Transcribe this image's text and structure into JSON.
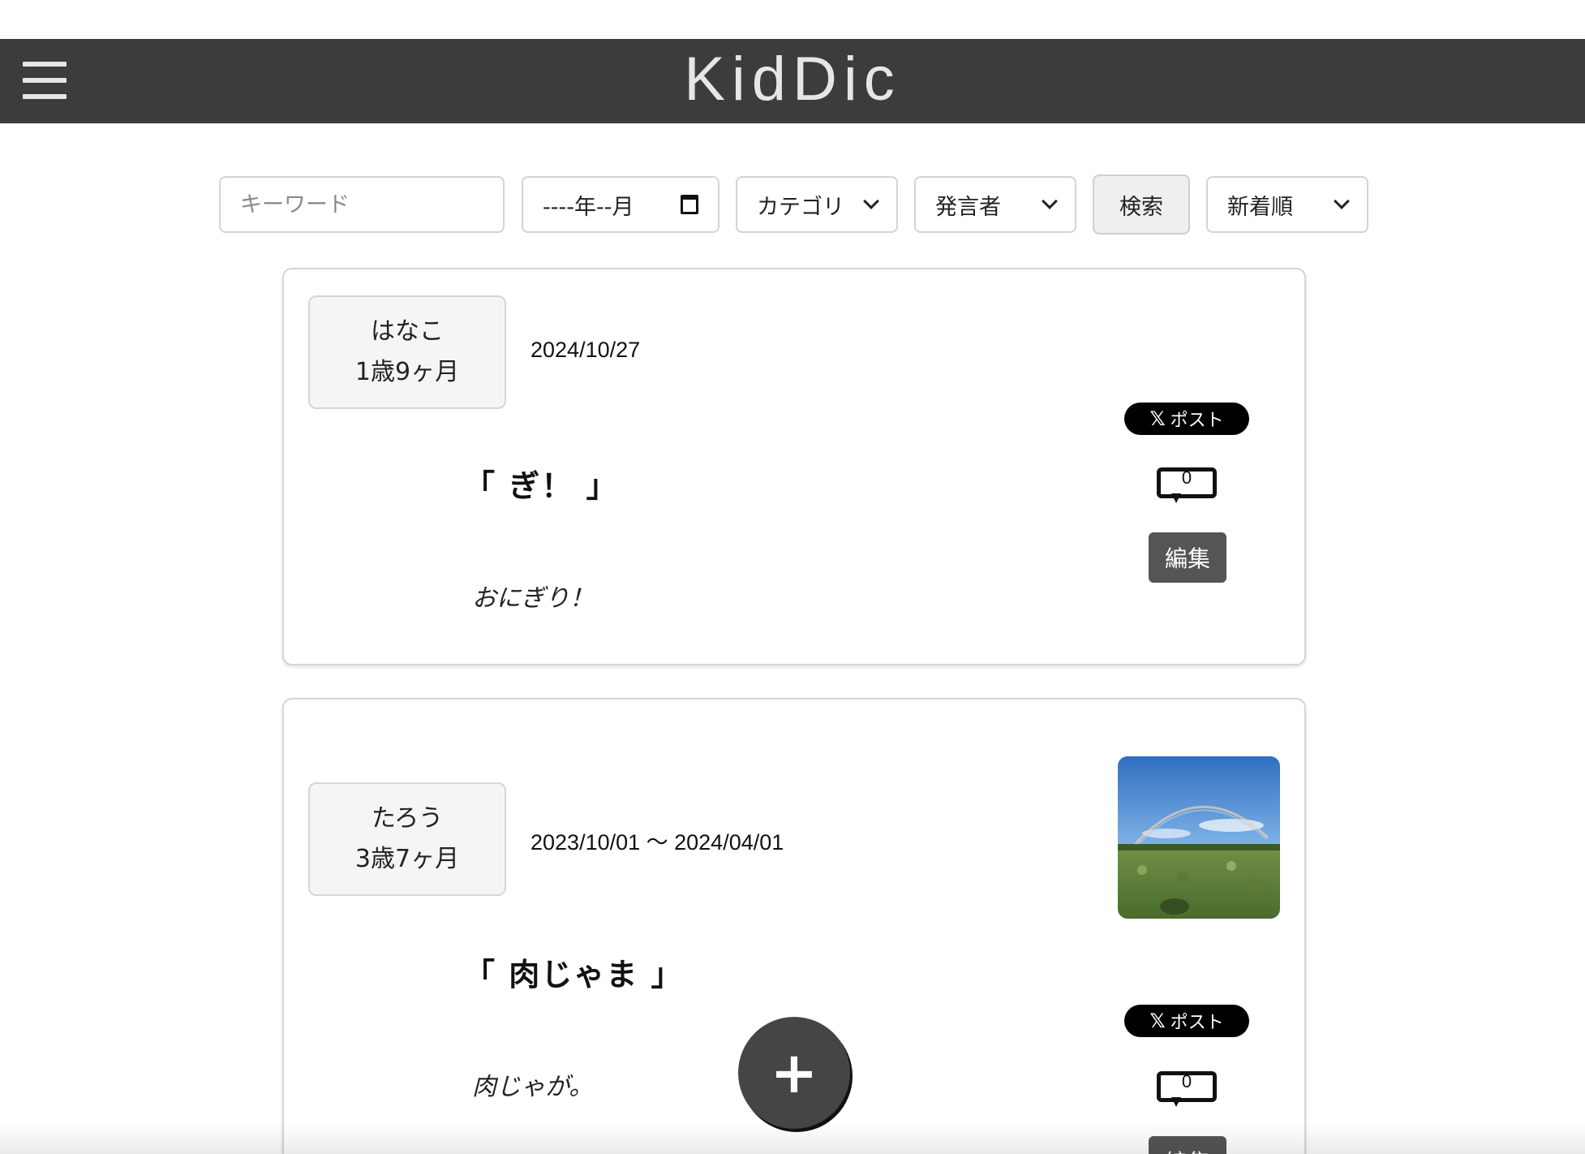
{
  "header": {
    "title": "KidDic",
    "menu_icon": "hamburger-icon"
  },
  "search": {
    "keyword_placeholder": "キーワード",
    "month_value": "----年--月",
    "category_selected": "カテゴリ",
    "speaker_selected": "発言者",
    "search_label": "検索",
    "sort_selected": "新着順"
  },
  "posts": [
    {
      "name": "はなこ",
      "age": "1歳9ヶ月",
      "date": "2024/10/27",
      "word": "「 ぎ！ 」",
      "meaning": "おにぎり！",
      "share_label": "ポスト",
      "comment_count": "0",
      "edit_label": "編集",
      "has_photo": false
    },
    {
      "name": "たろう",
      "age": "3歳7ヶ月",
      "date": "2023/10/01 〜 2024/04/01",
      "word": "「 肉じゃま 」",
      "meaning": "肉じゃが。",
      "share_label": "ポスト",
      "comment_count": "0",
      "edit_label": "編集",
      "has_photo": true
    }
  ],
  "fab": {
    "label": "+"
  },
  "colors": {
    "header_bg": "#3c3c3c",
    "header_text": "#e6e6e6",
    "edit_btn": "#555555",
    "fab_bg": "#454545",
    "share_bg": "#000000"
  }
}
